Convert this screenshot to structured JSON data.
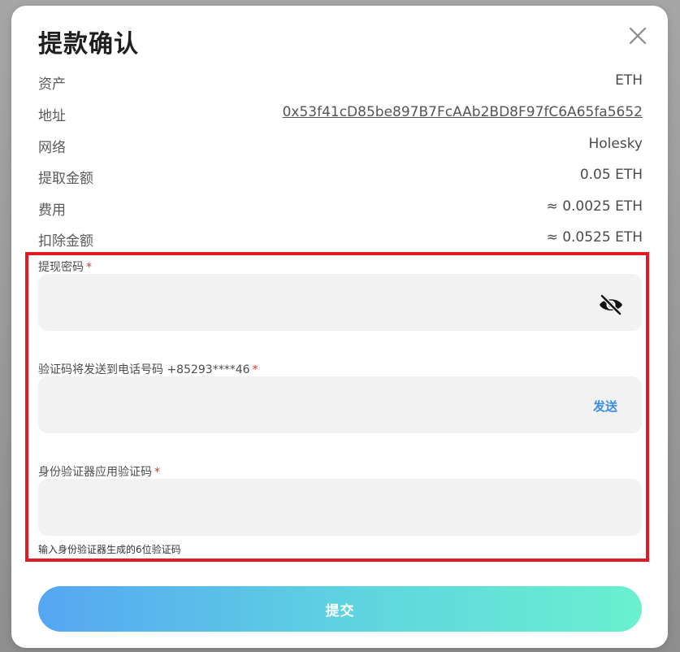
{
  "dialog": {
    "title": "提款确认",
    "close_icon": "close-icon"
  },
  "details": [
    {
      "label": "资产",
      "value": "ETH"
    },
    {
      "label": "地址",
      "value": "0x53f41cD85be897B7FcAAb2BD8F97fC6A65fa5652"
    },
    {
      "label": "网络",
      "value": "Holesky"
    },
    {
      "label": "提取金额",
      "value": "0.05 ETH"
    },
    {
      "label": "费用",
      "value": "≈ 0.0025 ETH"
    },
    {
      "label": "扣除金额",
      "value": "≈ 0.0525 ETH"
    }
  ],
  "form": {
    "password": {
      "label": "提现密码",
      "required_mark": "*",
      "value": "",
      "icon": "eye-slash-icon"
    },
    "sms_code": {
      "label": "验证码将发送到电话号码 +85293****46",
      "required_mark": "*",
      "value": "",
      "send_label": "发送"
    },
    "authenticator_code": {
      "label": "身份验证器应用验证码",
      "required_mark": "*",
      "value": "",
      "hint": "输入身份验证器生成的6位验证码"
    }
  },
  "submit_label": "提交",
  "colors": {
    "highlight_border": "#e01b24",
    "required": "#e0342a",
    "send_link": "#3a8ee6",
    "submit_gradient_start": "#56a6f3",
    "submit_gradient_end": "#6af0cf",
    "input_bg": "#f2f2f2"
  }
}
